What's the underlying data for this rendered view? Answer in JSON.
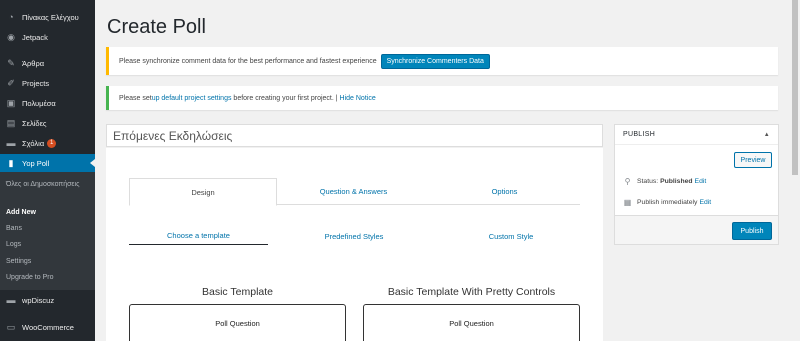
{
  "sidebar": {
    "items": [
      {
        "label": "Πίνακας Ελέγχου",
        "icon": "dashboard-icon"
      },
      {
        "label": "Jetpack",
        "icon": "jetpack-icon"
      },
      {
        "label": "Άρθρα",
        "icon": "pin-icon"
      },
      {
        "label": "Projects",
        "icon": "brush-icon"
      },
      {
        "label": "Πολυμέσα",
        "icon": "media-icon"
      },
      {
        "label": "Σελίδες",
        "icon": "pages-icon"
      },
      {
        "label": "Σχόλια",
        "icon": "comments-icon",
        "badge": "1"
      },
      {
        "label": "Yop Poll",
        "icon": "poll-icon"
      },
      {
        "label": "wpDiscuz",
        "icon": "chat-icon"
      },
      {
        "label": "WooCommerce",
        "icon": "woocommerce-icon"
      }
    ],
    "submenu": [
      {
        "label": "Όλες οι Δημοσκοπήσεις"
      },
      {
        "label": "Add New"
      },
      {
        "label": "Bans"
      },
      {
        "label": "Logs"
      },
      {
        "label": "Settings"
      },
      {
        "label": "Upgrade to Pro"
      }
    ]
  },
  "page": {
    "title": "Create Poll"
  },
  "notices": {
    "sync_text": "Please synchronize comment data for the best performance and fastest experience",
    "sync_button": "Synchronize Commenters Data",
    "setup_prefix": "Please set",
    "setup_link": "up default project settings",
    "setup_suffix": "before creating your first project. |",
    "hide_link": "Hide Notice"
  },
  "poll": {
    "title_value": "Επόμενες Εκδηλώσεις"
  },
  "tabs": [
    "Design",
    "Question & Answers",
    "Options"
  ],
  "subtabs": [
    "Choose a template",
    "Predefined Styles",
    "Custom Style"
  ],
  "templates": [
    {
      "heading": "Basic Template",
      "card_text": "Poll Question"
    },
    {
      "heading": "Basic Template With Pretty Controls",
      "card_text": "Poll Question"
    }
  ],
  "publish": {
    "heading": "PUBLISH",
    "preview_label": "Preview",
    "status_label": "Status:",
    "status_value": "Published",
    "status_edit": "Edit",
    "publish_text": "Publish immediately",
    "publish_edit": "Edit",
    "publish_button": "Publish"
  },
  "colors": {
    "sidebar_bg": "#23282d",
    "accent": "#0073aa",
    "button_primary": "#0085ba",
    "warning_border": "#ffb900",
    "success_border": "#46b450"
  }
}
